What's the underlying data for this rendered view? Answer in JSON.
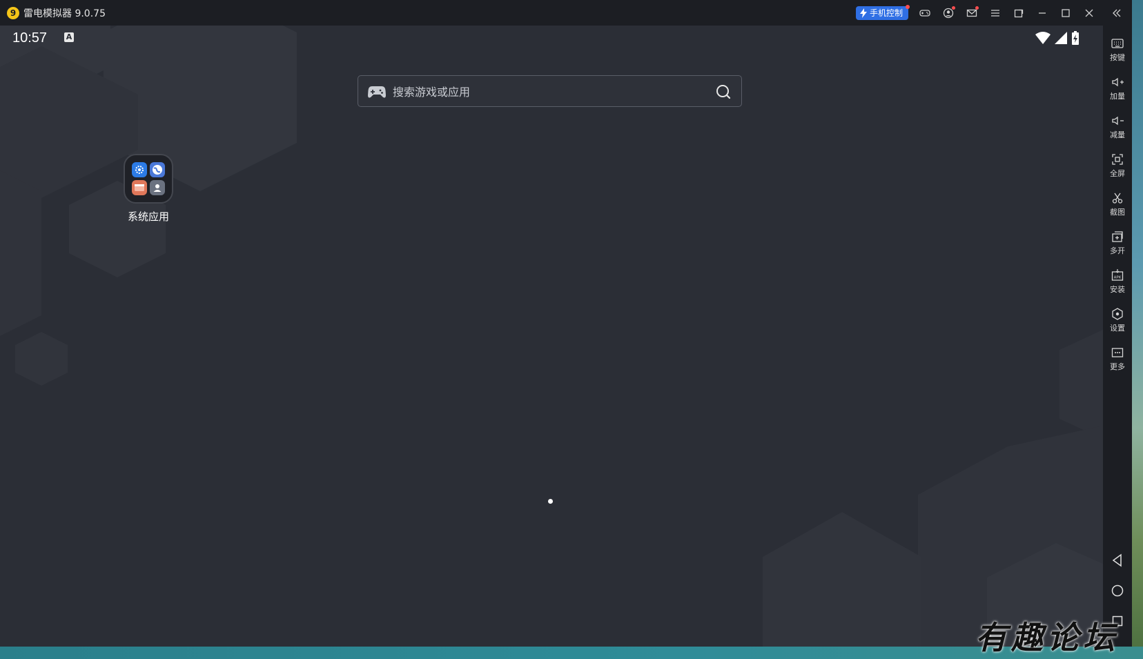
{
  "window": {
    "title": "雷电模拟器 9.0.75",
    "phone_control_label": "手机控制"
  },
  "status_bar": {
    "time": "10:57",
    "input_indicator": "A"
  },
  "search": {
    "placeholder": "搜索游戏或应用",
    "value": ""
  },
  "desktop": {
    "folder_label": "系统应用"
  },
  "toolbar": {
    "items": [
      {
        "label": "按键",
        "icon": "keyboard-icon"
      },
      {
        "label": "加量",
        "icon": "volume-up-icon"
      },
      {
        "label": "减量",
        "icon": "volume-down-icon"
      },
      {
        "label": "全屏",
        "icon": "fullscreen-icon"
      },
      {
        "label": "截图",
        "icon": "scissors-icon"
      },
      {
        "label": "多开",
        "icon": "multi-instance-icon"
      },
      {
        "label": "安装",
        "icon": "apk-install-icon"
      },
      {
        "label": "设置",
        "icon": "settings-icon"
      },
      {
        "label": "更多",
        "icon": "more-icon"
      }
    ]
  },
  "watermark": "有趣论坛",
  "colors": {
    "accent": "#2f6fe4",
    "screen_bg": "#2b2e36",
    "titlebar_bg": "#1c1e23"
  }
}
